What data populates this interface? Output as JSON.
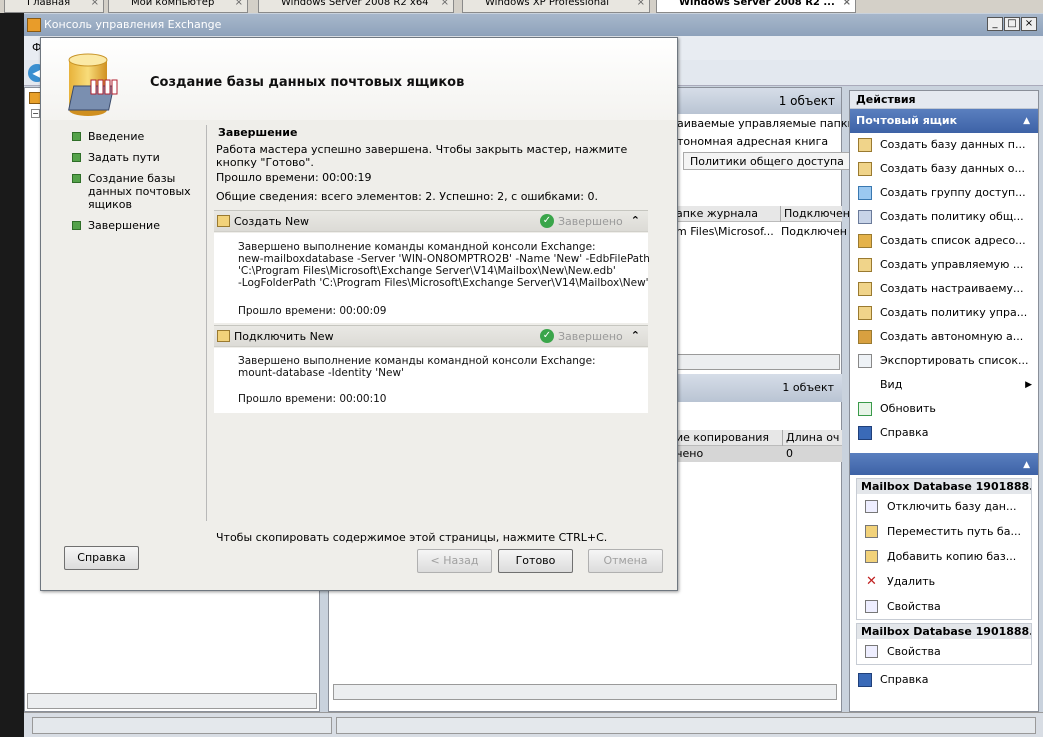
{
  "vm_tabs": [
    {
      "label": "Главная"
    },
    {
      "label": "Мой компьютер"
    },
    {
      "label": "Windows Server 2008 R2 x64"
    },
    {
      "label": "Windows XP Professional"
    },
    {
      "label": "Windows Server 2008 R2 ..."
    }
  ],
  "window": {
    "title": "Консоль управления Exchange",
    "menu_first": "Ф"
  },
  "center": {
    "header_count": "1 объект",
    "tabs": [
      "аиваемые управляемые папки",
      "тономная адресная книга",
      "Политики общего доступа"
    ],
    "grid_headers": [
      "апке журнала",
      "Подключен"
    ],
    "grid_row": [
      "m Files\\Microsof...",
      "Подключен"
    ],
    "lower_count": "1 объект",
    "lower_headers": [
      "ие копирования",
      "Длина оч"
    ],
    "lower_row": [
      "чено",
      "0"
    ]
  },
  "actions": {
    "title": "Действия",
    "section1": "Почтовый ящик",
    "items": [
      "Создать базу данных п...",
      "Создать базу данных о...",
      "Создать группу доступ...",
      "Создать политику общ...",
      "Создать список адресо...",
      "Создать управляемую ...",
      "Создать настраиваему...",
      "Создать политику упра...",
      "Создать автономную а...",
      "Экспортировать список...",
      "Вид",
      "Обновить",
      "Справка"
    ],
    "sub1": {
      "header": "Mailbox Database 1901888...",
      "items": [
        "Отключить базу дан...",
        "Переместить путь ба...",
        "Добавить копию баз...",
        "Удалить",
        "Свойства"
      ]
    },
    "sub2": {
      "header": "Mailbox Database 1901888...",
      "items": [
        "Свойства"
      ]
    },
    "help": "Справка"
  },
  "dialog": {
    "title": "Создание базы данных почтовых ящиков",
    "steps": [
      "Введение",
      "Задать пути",
      "Создание базы данных почтовых ящиков",
      "Завершение"
    ],
    "heading": "Завершение",
    "intro": "Работа мастера успешно завершена. Чтобы закрыть мастер, нажмите кнопку \"Готово\".",
    "elapsed": "Прошло времени: 00:00:19",
    "summary": "Общие сведения: всего элементов: 2. Успешно: 2, с ошибками: 0.",
    "task1": {
      "name": "Создать New",
      "status": "Завершено",
      "lines": [
        "Завершено выполнение команды командной консоли Exchange:",
        "new-mailboxdatabase -Server 'WIN-ON8OMPTRO2B' -Name 'New' -EdbFilePath",
        "'C:\\Program Files\\Microsoft\\Exchange Server\\V14\\Mailbox\\New\\New.edb'",
        "-LogFolderPath 'C:\\Program Files\\Microsoft\\Exchange Server\\V14\\Mailbox\\New'"
      ],
      "elapsed": "Прошло времени: 00:00:09"
    },
    "task2": {
      "name": "Подключить New",
      "status": "Завершено",
      "lines": [
        "Завершено выполнение команды командной консоли Exchange:",
        "mount-database -Identity 'New'"
      ],
      "elapsed": "Прошло времени: 00:00:10"
    },
    "copy_hint": "Чтобы скопировать содержимое этой страницы, нажмите CTRL+C.",
    "buttons": {
      "help": "Справка",
      "back": "< Назад",
      "finish": "Готово",
      "cancel": "Отмена"
    }
  }
}
